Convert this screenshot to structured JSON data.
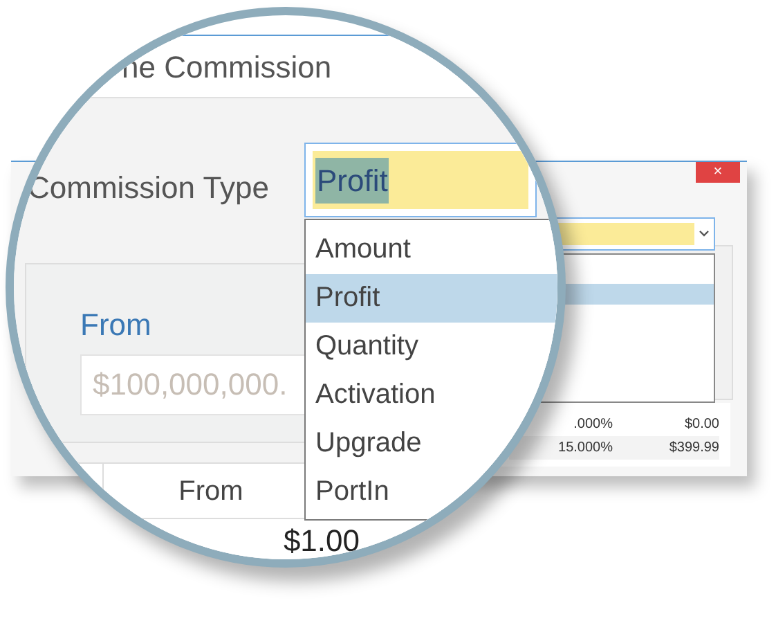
{
  "back_window": {
    "close": "×",
    "table_rows": [
      {
        "cells": [
          ".000%",
          "$0.00"
        ]
      },
      {
        "cells": [
          "15.000%",
          "$399.99"
        ]
      }
    ]
  },
  "magnifier": {
    "title": "ne Commission",
    "commission_type": {
      "label": "Commission Type",
      "value": "Profit",
      "options": [
        {
          "label": "Amount",
          "selected": false
        },
        {
          "label": "Profit",
          "selected": true
        },
        {
          "label": "Quantity",
          "selected": false
        },
        {
          "label": "Activation",
          "selected": false
        },
        {
          "label": "Upgrade",
          "selected": false
        },
        {
          "label": "PortIn",
          "selected": false
        }
      ]
    },
    "from": {
      "label": "From",
      "placeholder": "$100,000,000."
    },
    "table": {
      "columns": [
        "From"
      ],
      "rows": [
        [
          "$1.00"
        ]
      ]
    }
  }
}
